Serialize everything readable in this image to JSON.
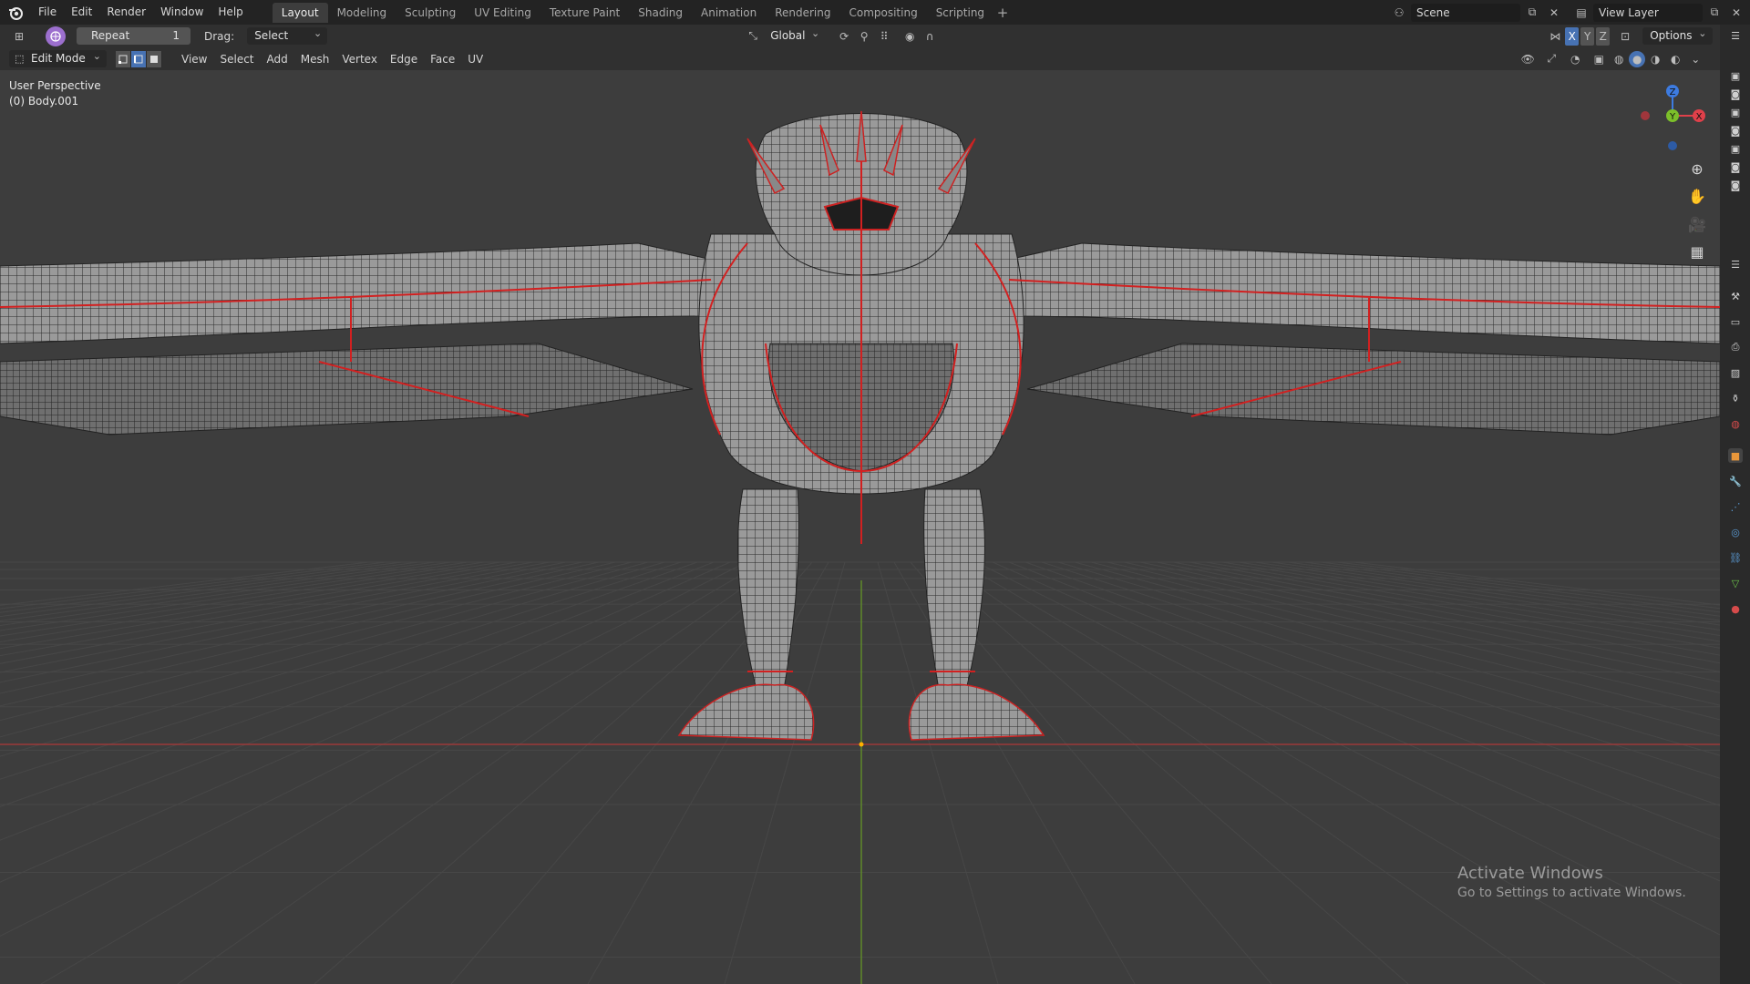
{
  "menubar": {
    "items": [
      "File",
      "Edit",
      "Render",
      "Window",
      "Help"
    ],
    "workspaces": [
      "Layout",
      "Modeling",
      "Sculpting",
      "UV Editing",
      "Texture Paint",
      "Shading",
      "Animation",
      "Rendering",
      "Compositing",
      "Scripting"
    ],
    "active_workspace": "Layout",
    "scene": "Scene",
    "view_layer": "View Layer"
  },
  "tool_header": {
    "last_op_label": "Repeat",
    "last_op_value": "1",
    "drag_label": "Drag:",
    "drag_value": "Select Box",
    "orientation": "Global",
    "axes": [
      "X",
      "Y",
      "Z"
    ],
    "options_label": "Options"
  },
  "viewport_header": {
    "mode": "Edit Mode",
    "menus": [
      "View",
      "Select",
      "Add",
      "Mesh",
      "Vertex",
      "Edge",
      "Face",
      "UV"
    ]
  },
  "viewport": {
    "perspective": "User Perspective",
    "object": "(0) Body.001",
    "gizmo_axes": {
      "z": "Z",
      "y": "Y",
      "x": "X"
    }
  },
  "watermark": {
    "title": "Activate Windows",
    "subtitle": "Go to Settings to activate Windows."
  },
  "colors": {
    "topbar": "#232323",
    "header": "#303030",
    "viewport": "#3d3d3d",
    "accent": "#4772b3",
    "seam": "#d22020",
    "axis_x": "#e0404a",
    "axis_y": "#7cbf2a",
    "axis_z": "#3d7be0"
  }
}
